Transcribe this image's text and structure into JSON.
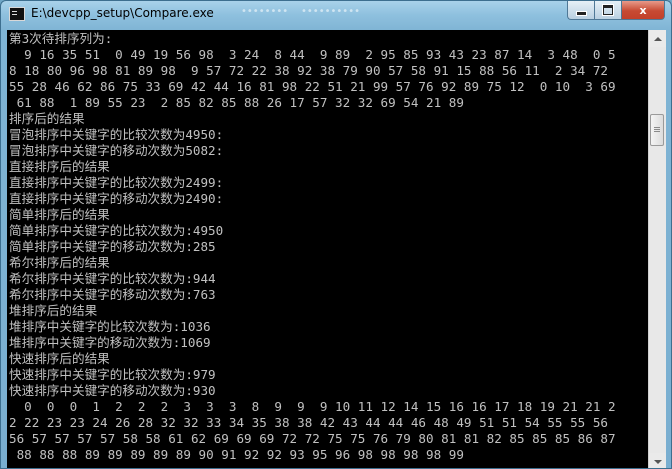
{
  "window": {
    "title": "E:\\devcpp_setup\\Compare.exe",
    "ghost_title_1": "••••••••",
    "ghost_title_2": "••••••••••",
    "controls": {
      "minimize": "minimize",
      "maximize": "maximize",
      "close": "x"
    }
  },
  "console": {
    "lines": [
      "第3次待排序列为:",
      "  9 16 35 51  0 49 19 56 98  3 24  8 44  9 89  2 95 85 93 43 23 87 14  3 48  0 5",
      "8 18 80 96 98 81 89 98  9 57 72 22 38 92 38 79 90 57 58 91 15 88 56 11  2 34 72",
      "55 28 46 62 86 75 33 69 42 44 16 81 98 22 51 21 99 57 76 92 89 75 12  0 10  3 69",
      " 61 88  1 89 55 23  2 85 82 85 88 26 17 57 32 32 69 54 21 89",
      "排序后的结果",
      "冒泡排序中关键字的比较次数为4950:",
      "冒泡排序中关键字的移动次数为5082:",
      "直接排序后的结果",
      "直接排序中关键字的比较次数为2499:",
      "直接排序中关键字的移动次数为2490:",
      "简单排序后的结果",
      "简单排序中关键字的比较次数为:4950",
      "简单排序中关键字的移动次数为:285",
      "希尔排序后的结果",
      "希尔排序中关键字的比较次数为:944",
      "希尔排序中关键字的移动次数为:763",
      "堆排序后的结果",
      "堆排序中关键字的比较次数为:1036",
      "堆排序中关键字的移动次数为:1069",
      "快速排序后的结果",
      "快速排序中关键字的比较次数为:979",
      "快速排序中关键字的移动次数为:930",
      "  0  0  0  1  2  2  2  3  3  3  8  9  9  9 10 11 12 14 15 16 16 17 18 19 21 21 2",
      "2 22 23 23 24 26 28 32 32 33 34 35 38 38 42 43 44 44 46 48 49 51 51 54 55 55 56",
      "56 57 57 57 57 58 58 61 62 69 69 69 72 72 75 75 76 79 80 81 81 82 85 85 85 86 87",
      " 88 88 88 89 89 89 89 89 90 91 92 92 93 95 96 98 98 98 98 99"
    ]
  },
  "colors": {
    "console_bg": "#000000",
    "console_text": "#c0c0c0",
    "close_button": "#c74a33",
    "frame": "#79aed0"
  },
  "scrollbar": {
    "position_fraction": 0.18
  }
}
